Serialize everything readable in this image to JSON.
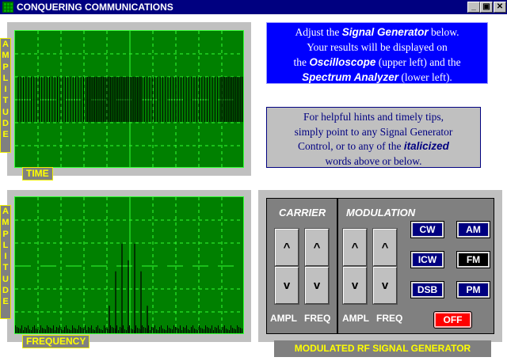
{
  "window": {
    "title": "CONQUERING COMMUNICATIONS",
    "minimize": "_",
    "restore": "▣",
    "close": "✕"
  },
  "oscilloscope": {
    "y_label": "AMPLITUDE",
    "x_label": "TIME"
  },
  "spectrum": {
    "y_label": "AMPLITUDE",
    "x_label": "FREQUENCY",
    "sideband_amplitudes": [
      0.2,
      0.45,
      0.65,
      0.53,
      0.65,
      0.45,
      0.2
    ]
  },
  "info": {
    "p1": [
      "Adjust the ",
      "Signal Generator",
      " below.",
      "Your results will be displayed on",
      "the ",
      "Oscilloscope",
      " (upper left) and the",
      "Spectrum Analyzer",
      " (lower left)."
    ],
    "p2": [
      "For helpful hints and timely tips,",
      "simply point to any Signal Generator",
      "Control, or to any of the ",
      "italicized",
      "words above or below."
    ]
  },
  "generator": {
    "carrier": "CARRIER",
    "modulation": "MODULATION",
    "up": "^",
    "down": "v",
    "ampl": "AMPL",
    "freq": "FREQ",
    "modes": [
      "CW",
      "AM",
      "ICW",
      "FM",
      "DSB",
      "PM"
    ],
    "selected_mode": "FM",
    "power": "OFF",
    "label": "MODULATED RF SIGNAL GENERATOR",
    "colors": {
      "mode": "#000080",
      "selected": "#000000",
      "off": "#ff0000"
    }
  }
}
